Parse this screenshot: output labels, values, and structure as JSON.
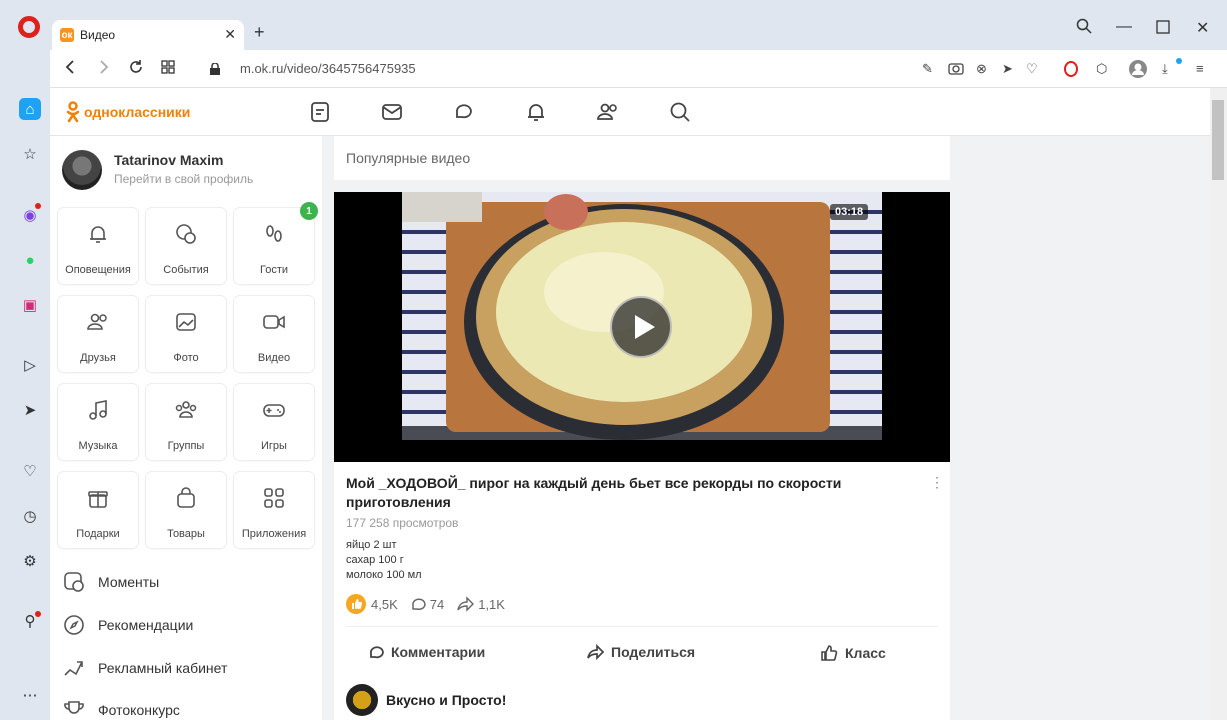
{
  "browser": {
    "tab_title": "Видео",
    "url": "m.ok.ru/video/3645756475935"
  },
  "site": {
    "logo_text": "одноклассники"
  },
  "profile": {
    "name": "Tatarinov Maxim",
    "subtitle": "Перейти в свой профиль"
  },
  "tiles": [
    {
      "label": "Оповещения",
      "icon": "bell-icon"
    },
    {
      "label": "События",
      "icon": "events-icon"
    },
    {
      "label": "Гости",
      "icon": "footprints-icon",
      "badge": "1"
    },
    {
      "label": "Друзья",
      "icon": "friends-icon"
    },
    {
      "label": "Фото",
      "icon": "photo-icon"
    },
    {
      "label": "Видео",
      "icon": "video-icon"
    },
    {
      "label": "Музыка",
      "icon": "music-icon"
    },
    {
      "label": "Группы",
      "icon": "groups-icon"
    },
    {
      "label": "Игры",
      "icon": "gamepad-icon"
    },
    {
      "label": "Подарки",
      "icon": "gift-icon"
    },
    {
      "label": "Товары",
      "icon": "bag-icon"
    },
    {
      "label": "Приложения",
      "icon": "apps-icon"
    }
  ],
  "menu": [
    {
      "label": "Моменты",
      "icon": "moments-icon"
    },
    {
      "label": "Рекомендации",
      "icon": "compass-icon"
    },
    {
      "label": "Рекламный кабинет",
      "icon": "megaphone-icon"
    },
    {
      "label": "Фотоконкурс",
      "icon": "trophy-icon"
    }
  ],
  "feed": {
    "section_title": "Популярные видео",
    "video": {
      "duration": "03:18",
      "title": "Мой _ХОДОВОЙ_ пирог на каждый день бьет все рекорды по скорости приготовления",
      "views": "177 258 просмотров",
      "description": [
        "яйцо 2 шт",
        "сахар 100 г",
        "молоко 100 мл"
      ],
      "likes": "4,5K",
      "comments": "74",
      "shares": "1,1K"
    },
    "actions": {
      "comments": "Комментарии",
      "share": "Поделиться",
      "klass": "Класс"
    },
    "channel": "Вкусно и Просто!"
  },
  "colors": {
    "ok_orange": "#ee8208",
    "opera_red": "#e0201b",
    "badge_green": "#3cb34e"
  }
}
